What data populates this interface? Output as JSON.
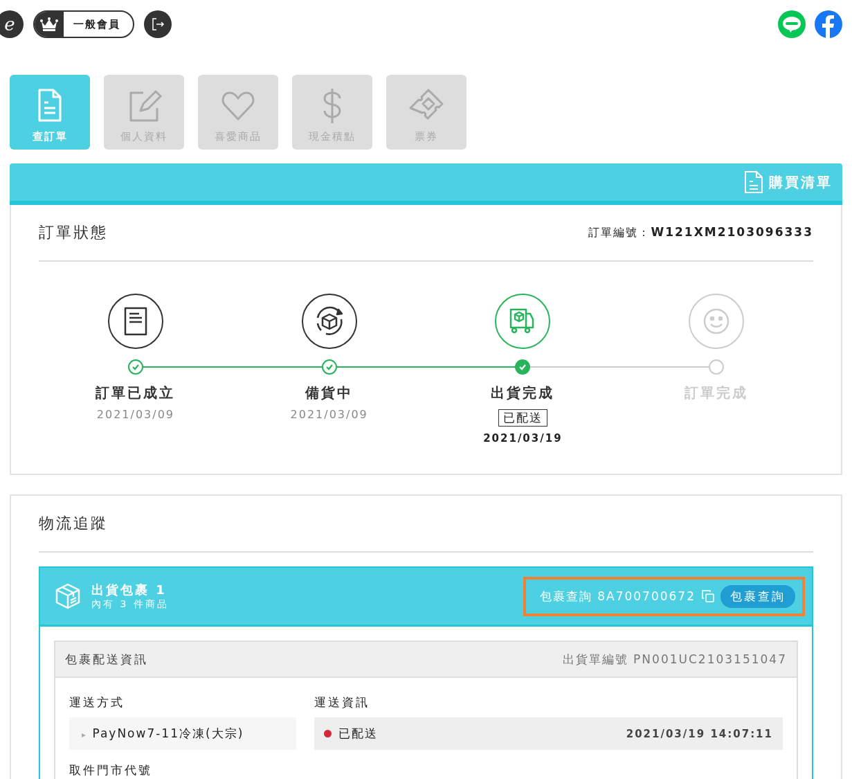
{
  "header": {
    "logo": "e",
    "member_level": "一般會員"
  },
  "tabs": [
    {
      "label": "查訂單",
      "kind": "document",
      "selected": true
    },
    {
      "label": "個人資料",
      "kind": "edit",
      "selected": false
    },
    {
      "label": "喜愛商品",
      "kind": "heart",
      "selected": false
    },
    {
      "label": "現金積點",
      "kind": "dollar",
      "selected": false
    },
    {
      "label": "票券",
      "kind": "ticket",
      "selected": false
    }
  ],
  "banner": {
    "link": "購買清單"
  },
  "order_status": {
    "title": "訂單狀態",
    "number_label": "訂單編號：",
    "number": "W121XM2103096333",
    "steps": [
      {
        "label": "訂單已成立",
        "date": "2021/03/09",
        "kind": "document",
        "completed": true,
        "current": false
      },
      {
        "label": "備貨中",
        "date": "2021/03/09",
        "kind": "box",
        "completed": true,
        "current": false
      },
      {
        "label": "出貨完成",
        "badge": "已配送",
        "date": "2021/03/19",
        "kind": "truck",
        "completed": true,
        "current": true
      },
      {
        "label": "訂單完成",
        "kind": "smile",
        "completed": false,
        "current": false
      }
    ]
  },
  "logistics": {
    "title": "物流追蹤",
    "package": {
      "title": "出貨包裹 1",
      "subtitle": "內有 3 件商品",
      "tracking_label": "包裹查詢 8A700700672",
      "query_button": "包裹查詢",
      "highlighted": true,
      "info_title": "包裹配送資訊",
      "shipment_number": "出貨單編號 PN001UC2103151047",
      "method_label": "運送方式",
      "method": "PayNow7-11冷凍(大宗)",
      "method_marker": "▸",
      "tracking_info_label": "運送資訊",
      "tracking_status": "已配送",
      "color": "#d2283c",
      "tracking_time": "2021/03/19 14:07:11",
      "store_code_label": "取件門市代號"
    }
  }
}
